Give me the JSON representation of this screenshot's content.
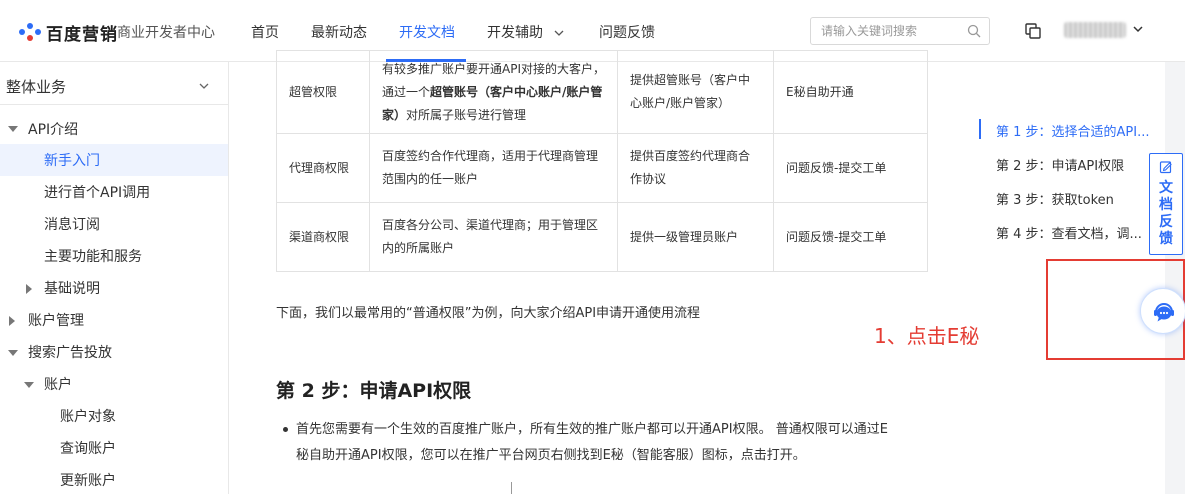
{
  "header": {
    "brand": "百度营销",
    "brand_sub": "商业开发者中心",
    "nav": [
      "首页",
      "最新动态",
      "开发文档",
      "开发辅助",
      "问题反馈"
    ],
    "search_placeholder": "请输入关键词搜索"
  },
  "sidebar": {
    "title": "整体业务",
    "items": [
      "API介绍",
      "新手入门",
      "进行首个API调用",
      "消息订阅",
      "主要功能和服务",
      "基础说明",
      "账户管理",
      "搜索广告投放",
      "账户",
      "账户对象",
      "查询账户",
      "更新账户"
    ]
  },
  "table": {
    "rows": [
      {
        "name": "超管权限",
        "desc_pre": "有较多推广账户要开通API对接的大客户，通过一个",
        "desc_bold": "超管账号（客户中心账户/账户管家）",
        "desc_post": "对所属子账号进行管理",
        "cond": "提供超管账号（客户中心账户/账户管家）",
        "method": "E秘自助开通"
      },
      {
        "name": "代理商权限",
        "desc": "百度签约合作代理商，适用于代理商管理范围内的任一账户",
        "cond": "提供百度签约代理商合作协议",
        "method": "问题反馈-提交工单"
      },
      {
        "name": "渠道商权限",
        "desc": "百度各分公司、渠道代理商；用于管理区内的所属账户",
        "cond": "提供一级管理员账户",
        "method": "问题反馈-提交工单"
      }
    ]
  },
  "content": {
    "intro": "下面，我们以最常用的“普通权限”为例，向大家介绍API申请开通使用流程",
    "annotation": "1、点击E秘",
    "step2_title": "第 2 步：申请API权限",
    "bullet_line1": "首先您需要有一个生效的百度推广账户，所有生效的推广账户都可以开通API权限。 普通权限可以通过E",
    "bullet_line2": "秘自助开通API权限，您可以在推广平台网页右侧找到E秘（智能客服）图标，点击打开。"
  },
  "toc": [
    "第 1 步：选择合适的API...",
    "第 2 步：申请API权限",
    "第 3 步：获取token",
    "第 4 步：查看文档，调..."
  ],
  "feedback_tab": "文档反馈",
  "colors": {
    "accent": "#2d6cf6",
    "annotation": "#e43c33"
  }
}
